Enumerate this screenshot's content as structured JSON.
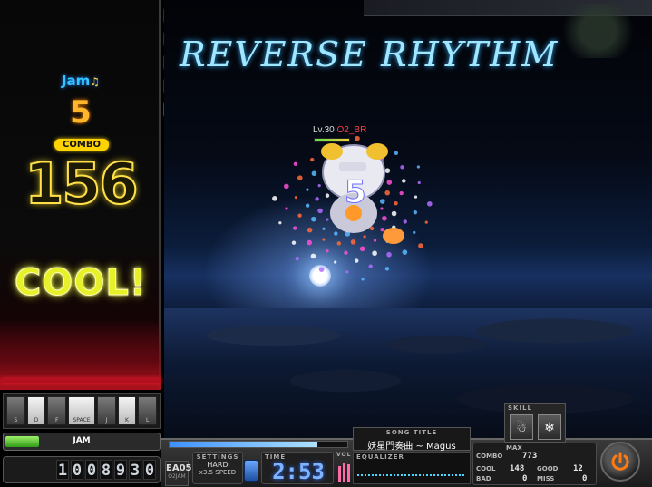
{
  "banner": {
    "text": "REVERSE RHYTHM"
  },
  "lane": {
    "jam_label": "Jam",
    "jam_note": "♫",
    "jam_count": "5",
    "combo_title": "COMBO",
    "combo_count": "156",
    "judgement": "COOL!"
  },
  "keys": [
    {
      "label": "S",
      "white": false
    },
    {
      "label": "D",
      "white": true
    },
    {
      "label": "F",
      "white": false
    },
    {
      "label": "SPACE",
      "white": true,
      "space": true
    },
    {
      "label": "J",
      "white": false
    },
    {
      "label": "K",
      "white": true
    },
    {
      "label": "L",
      "white": false
    }
  ],
  "jam_gauge": {
    "label": "JAM",
    "fill_fraction": 0.22
  },
  "score": {
    "digits": [
      "1",
      "0",
      "0",
      "8",
      "9",
      "3",
      "0"
    ]
  },
  "life_gauge": {
    "fill_fraction": 0.78
  },
  "option_badges": [
    "blue",
    "blue",
    "blue",
    "blue",
    "grey"
  ],
  "character": {
    "level_text": "Lv.30",
    "nickname": "O2_BR"
  },
  "progress": {
    "fill_fraction": 0.83
  },
  "mode_badge": {
    "big": "EA05",
    "small": "O2JAM"
  },
  "settings": {
    "label": "SETTINGS",
    "difficulty": "HARD",
    "speed": "x3.5 SPEED"
  },
  "time": {
    "label": "TIME",
    "value": "2:53"
  },
  "volume": {
    "label": "VOL"
  },
  "song_title": {
    "label": "SONG TITLE",
    "value": "妖星門奏曲 ~ Magus"
  },
  "equalizer": {
    "label": "EQUALIZER"
  },
  "stats": {
    "max_label": "MAX",
    "combo_label": "COMBO",
    "combo_value": "773",
    "cool_label": "COOL",
    "cool_value": "148",
    "good_label": "GOOD",
    "good_value": "12",
    "bad_label": "BAD",
    "bad_value": "0",
    "miss_label": "MISS",
    "miss_value": "0"
  },
  "skill": {
    "label": "SKILL",
    "slot1": "☃",
    "slot2": "❄"
  },
  "colors": {
    "accent_blue": "#4aa6ff",
    "judge_yellow": "#e7f12a",
    "gauge_orange": "#ff8a1a",
    "lane_red": "#b30f1e"
  }
}
